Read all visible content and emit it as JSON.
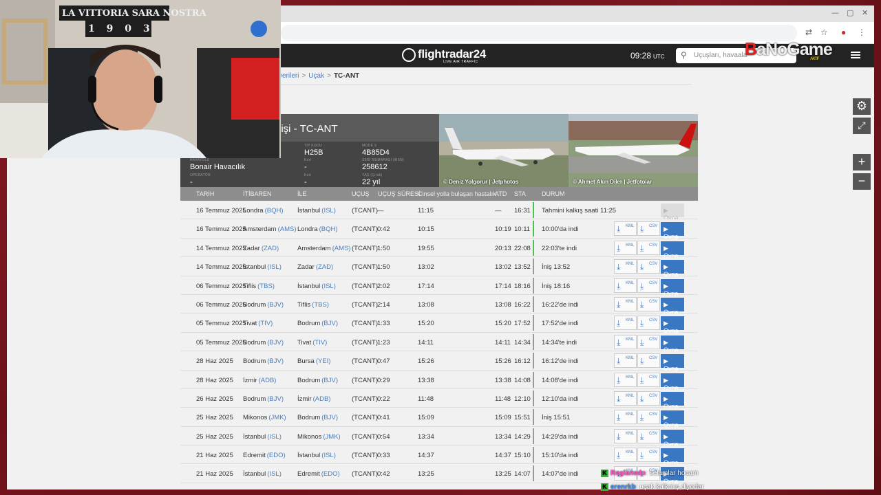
{
  "browser": {
    "address_placeholder": ""
  },
  "header": {
    "logo": "flightradar24",
    "logo_sub": "LIVE AIR TRAFFIC",
    "clock": "09:28",
    "clock_tz": "UTC",
    "search_placeholder": "Uçuşları, havaala"
  },
  "watermark": {
    "text_b": "B",
    "text_rest": "aNoGame",
    "tag": "AKTIF"
  },
  "breadcrumb": {
    "items": [
      "verileri",
      "Uçak"
    ],
    "current": "TC-ANT"
  },
  "aircraft": {
    "title": "nişi - TC-ANT",
    "airline_label": "HAVAYOLU",
    "airline": "Bonair Havacılık",
    "operator_label": "OPERATÖR",
    "operator": "-",
    "type_label": "TİP KODU",
    "type": "H25B",
    "code_label": "Kod",
    "code": "-",
    "code2_label": "Kod",
    "code2": "-",
    "modes_label": "MODE S",
    "modes": "4B85D4",
    "msn_label": "SERİ NUMARASI (MSN)",
    "msn": "258612",
    "age_label": "YAŞ (Çırak)",
    "age": "22 yıl",
    "photo1_caption": "© Deniz Yolgorur | Jetphotos",
    "photo2_caption": "© Ahmet Akın Diler | Jetfotolar"
  },
  "columns": [
    "TARİH",
    "İTİBAREN",
    "İLE",
    "UÇUŞ",
    "UÇUŞ SÜRESİ",
    "Cinsel yolla bulaşan hastalık",
    "ATD",
    "STA",
    "DURUM"
  ],
  "buttons": {
    "kml": "KML",
    "csv": "CSV",
    "play": "Oyna"
  },
  "flights": [
    {
      "date": "16 Temmuz 2025",
      "from": "Londra",
      "from_code": "(BQH)",
      "to": "İstanbul",
      "to_code": "(ISL)",
      "flight": "(TCANT)",
      "dur": "—",
      "std": "11:15",
      "atd": "—",
      "sta": "16:31",
      "status": "Tahmini kalkış saati 11:25",
      "color": "#4cc04c",
      "enabled": false
    },
    {
      "date": "16 Temmuz 2025",
      "from": "Amsterdam",
      "from_code": "(AMS)",
      "to": "Londra",
      "to_code": "(BQH)",
      "flight": "(TCANT)",
      "dur": "0:42",
      "std": "10:15",
      "atd": "10:19",
      "sta": "10:11",
      "status": "10:00'da indi",
      "color": "#4cc04c",
      "enabled": true
    },
    {
      "date": "14 Temmuz 2025",
      "from": "Zadar",
      "from_code": "(ZAD)",
      "to": "Amsterdam",
      "to_code": "(AMS)",
      "flight": "(TCANT)",
      "dur": "1:50",
      "std": "19:55",
      "atd": "20:13",
      "sta": "22:08",
      "status": "22:03'te indi",
      "color": "#4cc04c",
      "enabled": true
    },
    {
      "date": "14 Temmuz 2025",
      "from": "İstanbul",
      "from_code": "(ISL)",
      "to": "Zadar",
      "to_code": "(ZAD)",
      "flight": "(TCANT)",
      "dur": "1:50",
      "std": "13:02",
      "atd": "13:02",
      "sta": "13:52",
      "status": "İniş 13:52",
      "color": "#999",
      "enabled": true
    },
    {
      "date": "06 Temmuz 2025",
      "from": "Tiflis",
      "from_code": "(TBS)",
      "to": "İstanbul",
      "to_code": "(ISL)",
      "flight": "(TCANT)",
      "dur": "2:02",
      "std": "17:14",
      "atd": "17:14",
      "sta": "18:16",
      "status": "İniş 18:16",
      "color": "#999",
      "enabled": true
    },
    {
      "date": "06 Temmuz 2025",
      "from": "Bodrum",
      "from_code": "(BJV)",
      "to": "Tiflis",
      "to_code": "(TBS)",
      "flight": "(TCANT)",
      "dur": "2:14",
      "std": "13:08",
      "atd": "13:08",
      "sta": "16:22",
      "status": "16:22'de indi",
      "color": "#999",
      "enabled": true
    },
    {
      "date": "05 Temmuz 2025",
      "from": "Tivat",
      "from_code": "(TIV)",
      "to": "Bodrum",
      "to_code": "(BJV)",
      "flight": "(TCANT)",
      "dur": "1:33",
      "std": "15:20",
      "atd": "15:20",
      "sta": "17:52",
      "status": "17:52'de indi",
      "color": "#999",
      "enabled": true
    },
    {
      "date": "05 Temmuz 2025",
      "from": "Bodrum",
      "from_code": "(BJV)",
      "to": "Tivat",
      "to_code": "(TIV)",
      "flight": "(TCANT)",
      "dur": "1:23",
      "std": "14:11",
      "atd": "14:11",
      "sta": "14:34",
      "status": "14:34'te indi",
      "color": "#999",
      "enabled": true
    },
    {
      "date": "28 Haz 2025",
      "from": "Bodrum",
      "from_code": "(BJV)",
      "to": "Bursa",
      "to_code": "(YEI)",
      "flight": "(TCANT)",
      "dur": "0:47",
      "std": "15:26",
      "atd": "15:26",
      "sta": "16:12",
      "status": "16:12'de indi",
      "color": "#999",
      "enabled": true
    },
    {
      "date": "28 Haz 2025",
      "from": "İzmir",
      "from_code": "(ADB)",
      "to": "Bodrum",
      "to_code": "(BJV)",
      "flight": "(TCANT)",
      "dur": "0:29",
      "std": "13:38",
      "atd": "13:38",
      "sta": "14:08",
      "status": "14:08'de indi",
      "color": "#999",
      "enabled": true
    },
    {
      "date": "26 Haz 2025",
      "from": "Bodrum",
      "from_code": "(BJV)",
      "to": "İzmir",
      "to_code": "(ADB)",
      "flight": "(TCANT)",
      "dur": "0:22",
      "std": "11:48",
      "atd": "11:48",
      "sta": "12:10",
      "status": "12:10'da indi",
      "color": "#999",
      "enabled": true
    },
    {
      "date": "25 Haz 2025",
      "from": "Mikonos",
      "from_code": "(JMK)",
      "to": "Bodrum",
      "to_code": "(BJV)",
      "flight": "(TCANT)",
      "dur": "0:41",
      "std": "15:09",
      "atd": "15:09",
      "sta": "15:51",
      "status": "İniş 15:51",
      "color": "#999",
      "enabled": true
    },
    {
      "date": "25 Haz 2025",
      "from": "İstanbul",
      "from_code": "(ISL)",
      "to": "Mikonos",
      "to_code": "(JMK)",
      "flight": "(TCANT)",
      "dur": "0:54",
      "std": "13:34",
      "atd": "13:34",
      "sta": "14:29",
      "status": "14:29'da indi",
      "color": "#999",
      "enabled": true
    },
    {
      "date": "21 Haz 2025",
      "from": "Edremit",
      "from_code": "(EDO)",
      "to": "İstanbul",
      "to_code": "(ISL)",
      "flight": "(TCANT)",
      "dur": "0:33",
      "std": "14:37",
      "atd": "14:37",
      "sta": "15:10",
      "status": "15:10'da indi",
      "color": "#999",
      "enabled": true
    },
    {
      "date": "21 Haz 2025",
      "from": "İstanbul",
      "from_code": "(ISL)",
      "to": "Edremit",
      "to_code": "(EDO)",
      "flight": "(TCANT)",
      "dur": "0:42",
      "std": "13:25",
      "atd": "13:25",
      "sta": "14:07",
      "status": "14:07'de indi",
      "color": "#999",
      "enabled": true
    }
  ],
  "chat": [
    {
      "user": "Reglanedo",
      "sep": ":",
      "text": "selamlar hocam"
    },
    {
      "user": "erenrkb",
      "sep": ":",
      "text": "uçak kalkmış diyorlar"
    }
  ],
  "webcam": {
    "banner": "LA VITTORIA SARA NOSTRA",
    "digits": "1 9 0 3"
  }
}
